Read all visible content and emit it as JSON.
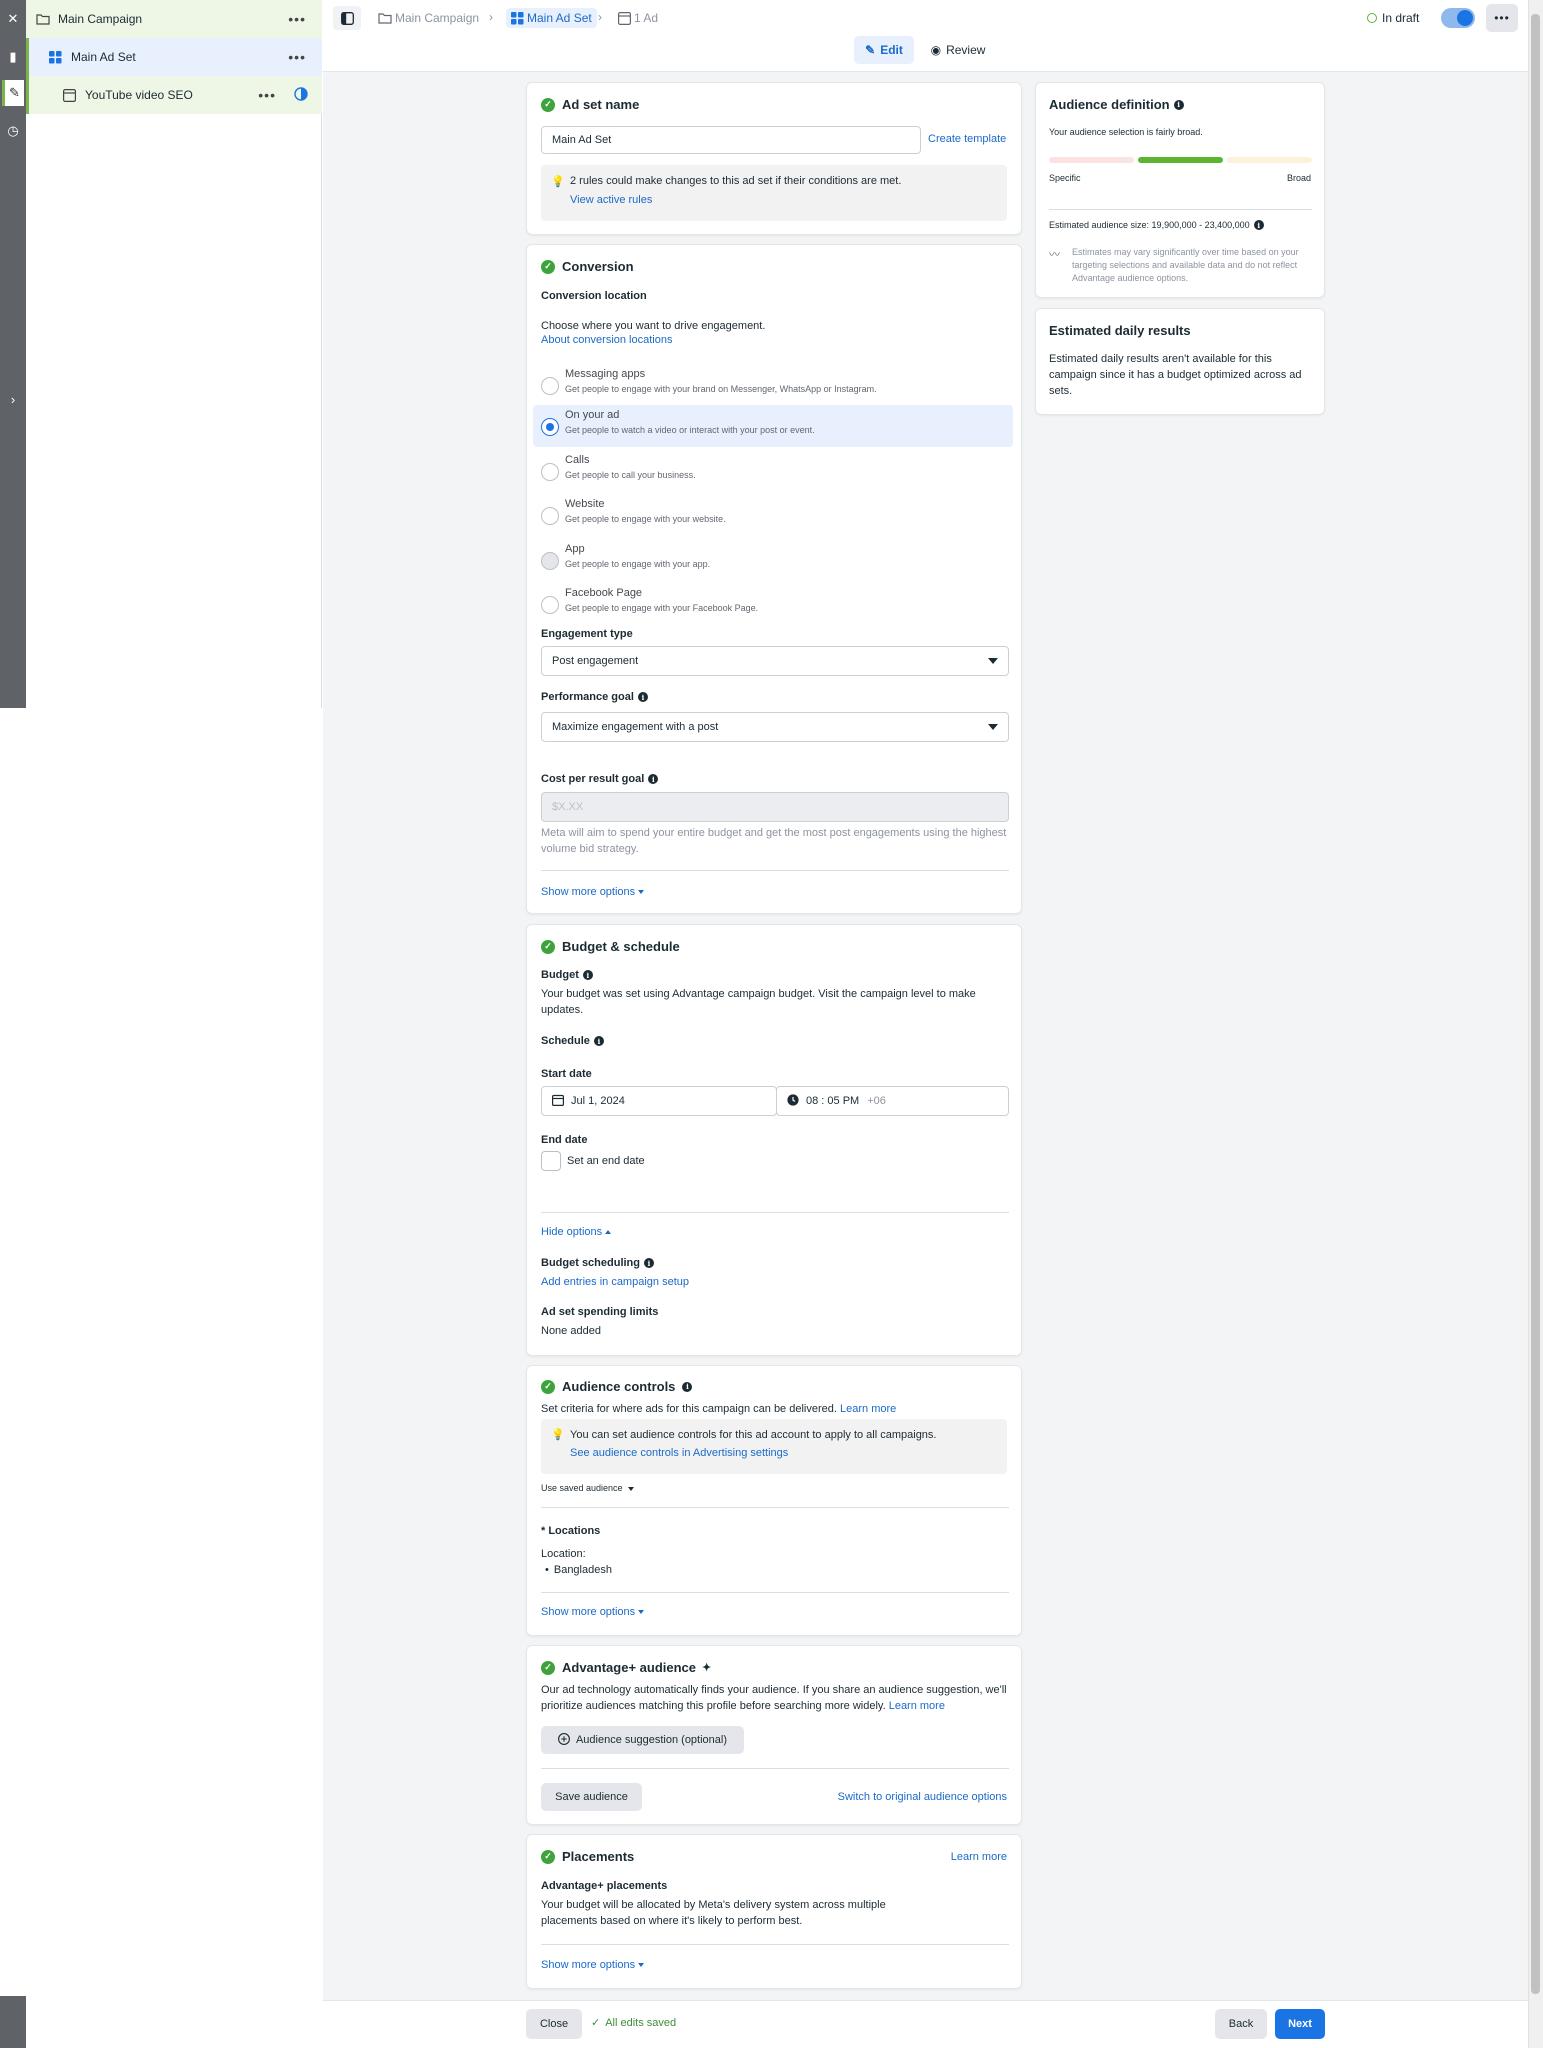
{
  "tree": {
    "campaign": "Main Campaign",
    "adset": "Main Ad Set",
    "ad": "YouTube video SEO"
  },
  "breadcrumb": {
    "campaign": "Main Campaign",
    "adset": "Main Ad Set",
    "ad": "1 Ad"
  },
  "header": {
    "status": "In draft",
    "edit_tab": "Edit",
    "review_tab": "Review"
  },
  "adset_name": {
    "title": "Ad set name",
    "value": "Main Ad Set",
    "create_template": "Create template",
    "rules_notice": "2 rules could make changes to this ad set if their conditions are met.",
    "view_rules": "View active rules"
  },
  "conversion": {
    "title": "Conversion",
    "location_label": "Conversion location",
    "location_desc": "Choose where you want to drive engagement.",
    "about_link": "About conversion locations",
    "options": [
      {
        "title": "Messaging apps",
        "desc": "Get people to engage with your brand on Messenger, WhatsApp or Instagram."
      },
      {
        "title": "On your ad",
        "desc": "Get people to watch a video or interact with your post or event."
      },
      {
        "title": "Calls",
        "desc": "Get people to call your business."
      },
      {
        "title": "Website",
        "desc": "Get people to engage with your website."
      },
      {
        "title": "App",
        "desc": "Get people to engage with your app."
      },
      {
        "title": "Facebook Page",
        "desc": "Get people to engage with your Facebook Page."
      }
    ],
    "selected_option": "On your ad",
    "engagement_type_label": "Engagement type",
    "engagement_type_value": "Post engagement",
    "performance_goal_label": "Performance goal",
    "performance_goal_value": "Maximize engagement with a post",
    "cost_goal_label": "Cost per result goal",
    "cost_goal_placeholder": "$X.XX",
    "cost_goal_help": "Meta will aim to spend your entire budget and get the most post engagements using the highest volume bid strategy.",
    "show_more": "Show more options"
  },
  "budget": {
    "title": "Budget & schedule",
    "budget_label": "Budget",
    "budget_desc": "Your budget was set using Advantage campaign budget. Visit the campaign level to make updates.",
    "schedule_label": "Schedule",
    "start_date_label": "Start date",
    "start_date": "Jul 1, 2024",
    "start_time": "08 : 05 PM",
    "timezone": "+06",
    "end_date_label": "End date",
    "end_date_checkbox": "Set an end date",
    "hide_options": "Hide options",
    "budget_scheduling_label": "Budget scheduling",
    "budget_scheduling_link": "Add entries in campaign setup",
    "spending_limits_label": "Ad set spending limits",
    "spending_limits_value": "None added"
  },
  "audience_controls": {
    "title": "Audience controls",
    "desc": "Set criteria for where ads for this campaign can be delivered.",
    "learn_more": "Learn more",
    "notice": "You can set audience controls for this ad account to apply to all campaigns.",
    "notice_link": "See audience controls in Advertising settings",
    "saved_audience": "Use saved audience",
    "locations_label": "* Locations",
    "location_prefix": "Location:",
    "location_value": "Bangladesh",
    "show_more": "Show more options"
  },
  "advantage": {
    "title": "Advantage+ audience",
    "desc": "Our ad technology automatically finds your audience. If you share an audience suggestion, we'll prioritize audiences matching this profile before searching more widely.",
    "learn_more": "Learn more",
    "suggestion_button": "Audience suggestion (optional)",
    "save_audience": "Save audience",
    "switch_link": "Switch to original audience options"
  },
  "placements": {
    "title": "Placements",
    "learn_more": "Learn more",
    "sub_label": "Advantage+ placements",
    "desc": "Your budget will be allocated by Meta's delivery system across multiple placements based on where it's likely to perform best.",
    "show_more": "Show more options"
  },
  "audience_definition": {
    "title": "Audience definition",
    "desc": "Your audience selection is fairly broad.",
    "specific": "Specific",
    "broad": "Broad",
    "size_label": "Estimated audience size: 19,900,000 - 23,400,000",
    "note": "Estimates may vary significantly over time based on your targeting selections and available data and do not reflect Advantage audience options."
  },
  "daily_results": {
    "title": "Estimated daily results",
    "desc": "Estimated daily results aren't available for this campaign since it has a budget optimized across ad sets."
  },
  "footer": {
    "close": "Close",
    "saved": "All edits saved",
    "back": "Back",
    "next": "Next"
  },
  "colors": {
    "accent": "#1b74e4",
    "success": "#3fa33d",
    "gauge_active": "#5bb531"
  }
}
